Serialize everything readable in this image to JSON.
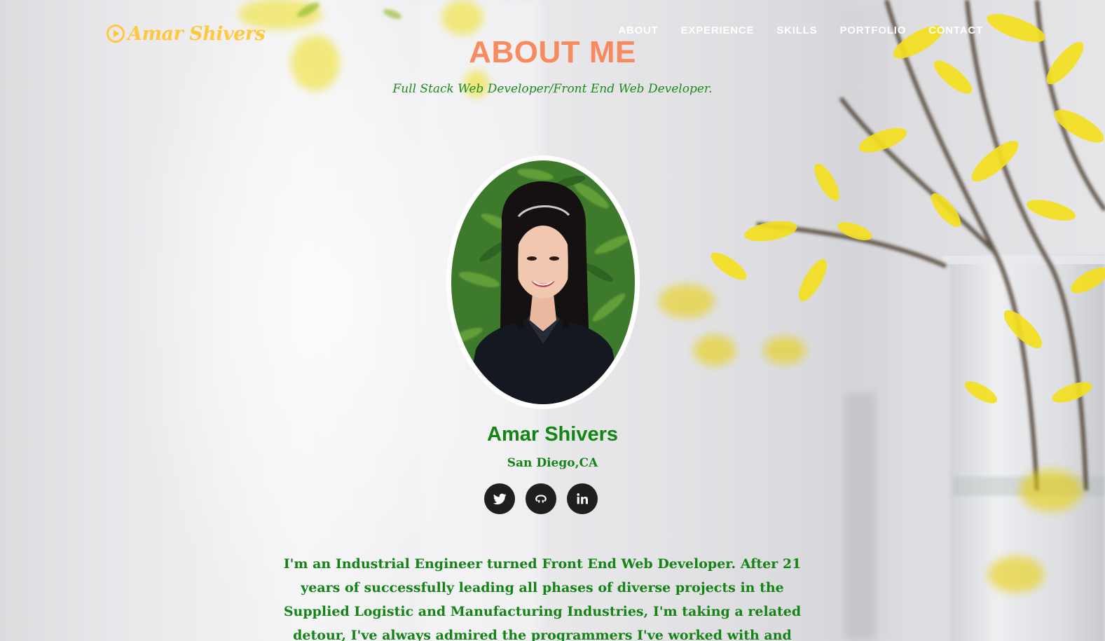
{
  "header": {
    "logo_text": "Amar Shivers",
    "logo_icon": "play-circle-icon",
    "brand_color": "#ffc83d"
  },
  "nav": {
    "items": [
      "ABOUT",
      "EXPERIENCE",
      "SKILLS",
      "PORTFOLIO",
      "CONTACT"
    ]
  },
  "about": {
    "title": "ABOUT ME",
    "subtitle": "Full Stack Web Developer/Front End Web Developer.",
    "name": "Amar Shivers",
    "location": "San Diego,CA",
    "bio": "I'm an Industrial Engineer turned Front End Web Developer. After 21 years of successfully leading all phases of diverse projects in the Supplied Logistic and Manufacturing Industries, I'm taking a related detour, I've always admired the programmers I've worked with and envied their ability to create tools that directly"
  },
  "socials": [
    {
      "icon": "twitter-icon"
    },
    {
      "icon": "github-icon"
    },
    {
      "icon": "linkedin-icon"
    }
  ],
  "colors": {
    "title": "#f98a5e",
    "green_text": "#148414",
    "social_bg": "#1f1f1f",
    "nav_text": "#ffffff"
  }
}
